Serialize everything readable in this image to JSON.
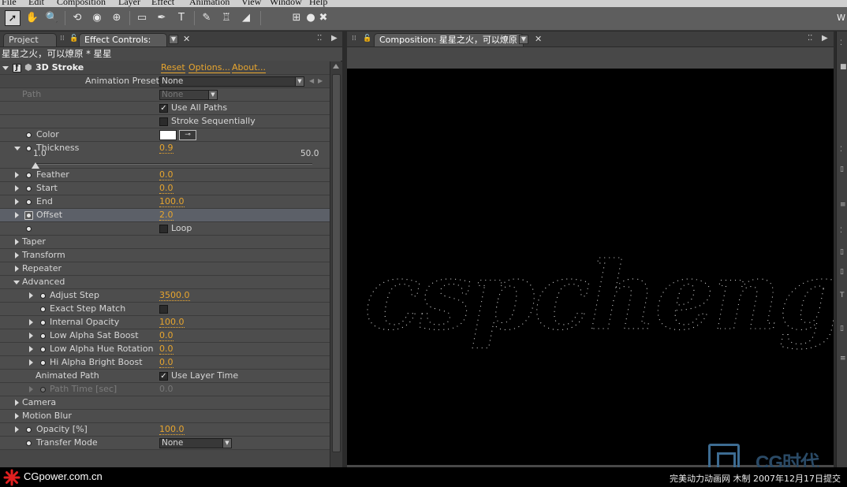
{
  "menu": [
    "File",
    "Edit",
    "Composition",
    "Layer",
    "Effect",
    "Animation",
    "View",
    "Window",
    "Help"
  ],
  "toolbar": {
    "tools": [
      "arrow-icon",
      "hand-icon",
      "zoom-icon",
      "rotate-icon",
      "orbit-camera-icon",
      "pan-behind-icon",
      "rectangle-mask-icon",
      "pen-icon",
      "text-icon",
      "brush-icon",
      "clone-stamp-icon",
      "eraser-icon",
      "axis-icon",
      "dot-icon",
      "close-small-icon"
    ],
    "tool_glyphs": [
      "➚",
      "✋",
      "🔍",
      "⟲",
      "◉",
      "⊕",
      "▭",
      "✒",
      "T",
      "✎",
      "♖",
      "◢",
      "⊞",
      "●",
      "✖"
    ],
    "workspace_letter": "W"
  },
  "left_panel": {
    "tabs": {
      "project": "Project",
      "effect_controls": "Effect Controls: 星星"
    },
    "layer_title": "星星之火，可以燎原 * 星星",
    "effect": {
      "name": "3D Stroke",
      "reset": "Reset",
      "options": "Options...",
      "about": "About...",
      "presets_label": "Animation Presets:",
      "presets_value": "None"
    },
    "path": {
      "label": "Path",
      "value": "None"
    },
    "use_all_paths": "Use All Paths",
    "stroke_sequentially": "Stroke Sequentially",
    "color": {
      "label": "Color",
      "hex": "#FFFFFF"
    },
    "thickness": {
      "label": "Thickness",
      "value": "0.9",
      "min": "1.0",
      "max": "50.0"
    },
    "feather": {
      "label": "Feather",
      "value": "0.0"
    },
    "start": {
      "label": "Start",
      "value": "0.0"
    },
    "end": {
      "label": "End",
      "value": "100.0"
    },
    "offset": {
      "label": "Offset",
      "value": "2.0"
    },
    "loop": "Loop",
    "groups": {
      "taper": "Taper",
      "transform": "Transform",
      "repeater": "Repeater",
      "advanced": "Advanced",
      "camera": "Camera",
      "motion_blur": "Motion Blur"
    },
    "advanced": {
      "adjust_step": {
        "label": "Adjust Step",
        "value": "3500.0"
      },
      "exact_step_match": "Exact Step Match",
      "internal_opacity": {
        "label": "Internal Opacity",
        "value": "100.0"
      },
      "low_alpha_sat_boost": {
        "label": "Low Alpha Sat Boost",
        "value": "0.0"
      },
      "low_alpha_hue_rotation": {
        "label": "Low Alpha Hue Rotation",
        "value": "0.0"
      },
      "hi_alpha_bright_boost": {
        "label": "Hi Alpha Bright Boost",
        "value": "0.0"
      },
      "animated_path": {
        "label": "Animated Path",
        "checkbox": "Use Layer Time"
      },
      "path_time": {
        "label": "Path Time [sec]",
        "value": "0.0"
      }
    },
    "opacity": {
      "label": "Opacity [%]",
      "value": "100.0"
    },
    "transfer_mode": {
      "label": "Transfer Mode",
      "value": "None"
    }
  },
  "comp_panel": {
    "tab": "Composition: 星星之火，可以燎原",
    "viewer_text": "cspcheng"
  },
  "watermark": {
    "text": "CG时代"
  },
  "bottom": {
    "brand": "CGpower.com.cn",
    "credit": "完美动力动画网 木制 2007年12月17日提交"
  },
  "colors": {
    "value_accent": "#E7A52E",
    "panel_bg": "#4D4D4D",
    "viewer_bg": "#000000",
    "brand_star": "#E02020",
    "watermark": "#3D6C92"
  }
}
